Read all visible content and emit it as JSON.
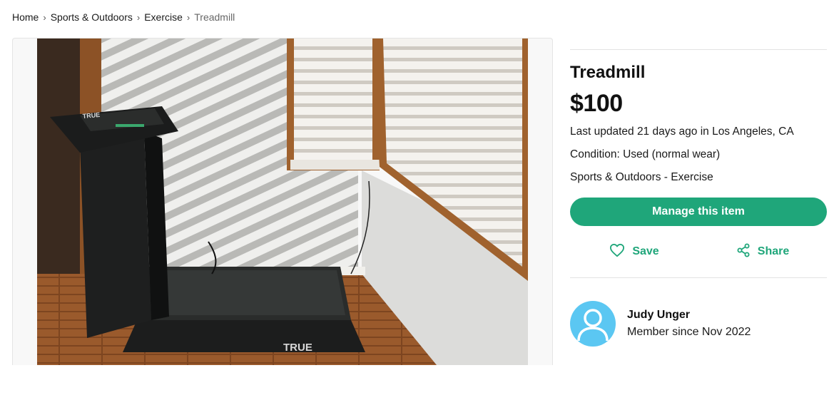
{
  "breadcrumb": {
    "home": "Home",
    "category": "Sports & Outdoors",
    "subcategory": "Exercise",
    "current": "Treadmill"
  },
  "listing": {
    "photo_icon": "treadmill-photo",
    "photo_brand_text": "TRUE",
    "title": "Treadmill",
    "price": "$100",
    "updated": "Last updated 21 days ago in Los Angeles, CA",
    "condition": "Condition: Used (normal wear)",
    "category_line": "Sports & Outdoors - Exercise"
  },
  "actions": {
    "manage_label": "Manage this item",
    "save_label": "Save",
    "share_label": "Share",
    "save_icon": "heart-icon",
    "share_icon": "share-icon"
  },
  "seller": {
    "name": "Judy Unger",
    "member_since": "Member since Nov 2022",
    "avatar_icon": "user-avatar-icon"
  },
  "colors": {
    "accent": "#1fa67a",
    "avatar_bg": "#5bc7f2"
  }
}
